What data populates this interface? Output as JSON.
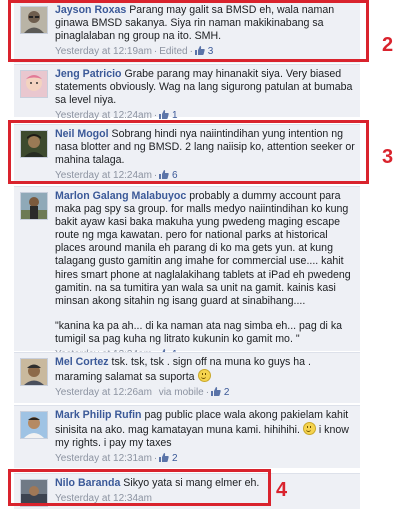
{
  "comments": [
    {
      "author": "Jayson Roxas",
      "text": "Parang may galit sa BMSD eh, wala naman ginawa BMSD sakanya. Siya rin naman makikinabang sa pinaglalaban ng group na ito. SMH.",
      "time": "Yesterday at 12:19am",
      "edited": "Edited",
      "likes": "3",
      "avatar_icon": "user-photo-man-glasses"
    },
    {
      "author": "Jeng Patricio",
      "text": "Grabe parang may hinanakit siya. Very biased statements obviously. Wag na lang sigurong patulan at bumaba sa level niya.",
      "time": "Yesterday at 12:24am",
      "likes": "1",
      "avatar_icon": "user-photo-baby"
    },
    {
      "author": "Neil Mogol",
      "text": "Sobrang hindi nya naiintindihan yung intention ng nasa blotter and ng BMSD. 2 lang naiisip ko, attention seeker or mahina talaga.",
      "time": "Yesterday at 12:24am",
      "likes": "6",
      "avatar_icon": "user-photo-man-dark"
    },
    {
      "author": "Marlon Galang Malabuyoc",
      "text": "probably a dummy account para maka pag spy sa group. for malls medyo naiintindihan ko kung bakit ayaw kasi baka makuha yung pwedeng maging escape route ng mga kawatan. pero for national parks at historical places around manila eh parang di ko ma gets yun. at kung talagang gusto gamitin ang imahe for commercial use.... kahit hires smart phone at naglalakihang tablets at iPad eh pwedeng gamitin. na sa tumitira yan wala sa unit na gamit. kainis kasi minsan akong sitahin ng isang guard at sinabihang....",
      "quote": "\"kanina ka pa ah... di ka naman ata nag simba eh... pag di ka tumigil sa pag kuha ng litrato kukunin ko gamit mo. \"",
      "time": "Yesterday at 12:24am",
      "likes": "1",
      "avatar_icon": "user-photo-man-outdoor"
    },
    {
      "author": "Mel Cortez",
      "text": "tsk. tsk, tsk . sign off na muna ko guys ha . maraming salamat sa suporta",
      "time": "Yesterday at 12:26am",
      "via": "via mobile",
      "likes": "2",
      "avatar_icon": "user-photo-man-cap"
    },
    {
      "author": "Mark Philip Rufin",
      "text": "pag public place wala akong pakielam kahit sinisita na ako. mag kamatayan muna kami. hihihihi.",
      "text_after": "i know my rights. i pay my taxes",
      "time": "Yesterday at 12:31am",
      "likes": "2",
      "avatar_icon": "user-photo-man-sky"
    },
    {
      "author": "Nilo Baranda",
      "text": "Sikyo yata si mang elmer eh.",
      "time": "Yesterday at 12:34am",
      "likes": "",
      "avatar_icon": "user-photo-man-car"
    }
  ],
  "markers": [
    "2",
    "3",
    "4"
  ],
  "colors": {
    "author": "#3b5998",
    "comment_bg": "#eef0f5",
    "meta": "#8c93a1",
    "highlight": "#d9232d"
  }
}
